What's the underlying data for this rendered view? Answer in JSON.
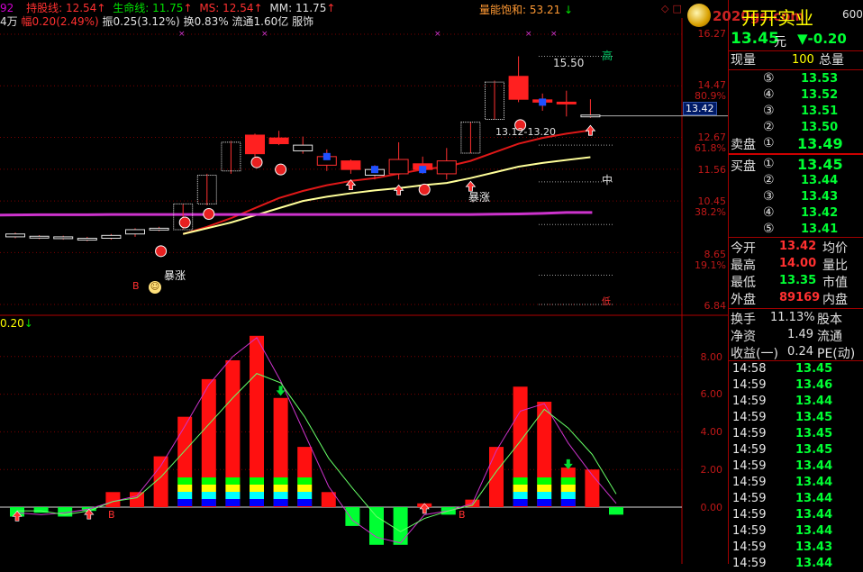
{
  "header": {
    "left_cut": "92",
    "hold_label": "持股线: 12.54",
    "life_label": "生命线: 11.75",
    "ms_label": "MS: 12.54",
    "mm_label": "MM: 11.75",
    "energy_label": "量能饱和: 53.21",
    "row2_vol": "4万",
    "row2_change": "幅0.20(2.49%)",
    "row2_amp": "振0.25(3.12%)",
    "row2_turn": "换0.83%",
    "row2_float": "流通1.60亿",
    "row2_sector": "服饰",
    "indicator_label": "0.20"
  },
  "stock": {
    "name": "开开实业",
    "code_cut": "600",
    "logo_url": "2020gs.com"
  },
  "price_axis": {
    "labels": [
      "16.27",
      "14.47",
      "80.9%",
      "12.67",
      "61.8%",
      "11.56",
      "10.45",
      "38.2%",
      "8.65",
      "19.1%",
      "6.84"
    ],
    "current": "13.42"
  },
  "indicator_axis": {
    "labels": [
      "8.00",
      "6.00",
      "4.00",
      "2.00",
      "0.00"
    ]
  },
  "annotations": {
    "high_price": "15.50",
    "high_tag": "高",
    "range_label": "13.12-13.20",
    "mid_tag": "中",
    "low_tag": "低",
    "surge1": "暴涨",
    "surge2": "暴涨",
    "buy1": "B",
    "buy2": "B",
    "buy3": "B"
  },
  "quote": {
    "price": "13.45",
    "unit": "元",
    "change": "▼-0.20",
    "now_label": "现量",
    "now_vol": "100",
    "total_label": "总量",
    "sell_label": "卖盘",
    "buy_label": "买盘",
    "sells": [
      {
        "level": "⑤",
        "price": "13.53"
      },
      {
        "level": "④",
        "price": "13.52"
      },
      {
        "level": "③",
        "price": "13.51"
      },
      {
        "level": "②",
        "price": "13.50"
      },
      {
        "level": "①",
        "price": "13.49"
      }
    ],
    "buys": [
      {
        "level": "①",
        "price": "13.45"
      },
      {
        "level": "②",
        "price": "13.44"
      },
      {
        "level": "③",
        "price": "13.43"
      },
      {
        "level": "④",
        "price": "13.42"
      },
      {
        "level": "⑤",
        "price": "13.41"
      }
    ],
    "stats": [
      {
        "label": "今开",
        "value": "13.42",
        "label2": "均价"
      },
      {
        "label": "最高",
        "value": "14.00",
        "label2": "量比"
      },
      {
        "label": "最低",
        "value": "13.35",
        "label2": "市值"
      },
      {
        "label": "外盘",
        "value": "89169",
        "label2": "内盘"
      }
    ],
    "stats2": [
      {
        "label": "换手",
        "value": "11.13%",
        "label2": "股本"
      },
      {
        "label": "净资",
        "value": "1.49",
        "label2": "流通"
      },
      {
        "label": "收益(一)",
        "value": "0.24",
        "label2": "PE(动)"
      }
    ]
  },
  "ticks": [
    {
      "time": "14:58",
      "price": "13.45"
    },
    {
      "time": "14:59",
      "price": "13.46"
    },
    {
      "time": "14:59",
      "price": "13.44"
    },
    {
      "time": "14:59",
      "price": "13.45"
    },
    {
      "time": "14:59",
      "price": "13.45"
    },
    {
      "time": "14:59",
      "price": "13.45"
    },
    {
      "time": "14:59",
      "price": "13.44"
    },
    {
      "time": "14:59",
      "price": "13.44"
    },
    {
      "time": "14:59",
      "price": "13.44"
    },
    {
      "time": "14:59",
      "price": "13.44"
    },
    {
      "time": "14:59",
      "price": "13.44"
    },
    {
      "time": "14:59",
      "price": "13.43"
    },
    {
      "time": "14:59",
      "price": "13.44"
    }
  ],
  "chart_data": [
    {
      "type": "candlestick",
      "ylim": [
        6.84,
        16.27
      ],
      "candles": [
        {
          "o": 9.2,
          "c": 9.3,
          "h": 9.35,
          "l": 9.15
        },
        {
          "o": 9.18,
          "c": 9.22,
          "h": 9.26,
          "l": 9.12
        },
        {
          "o": 9.15,
          "c": 9.2,
          "h": 9.24,
          "l": 9.1
        },
        {
          "o": 9.1,
          "c": 9.15,
          "h": 9.2,
          "l": 9.05
        },
        {
          "o": 9.15,
          "c": 9.25,
          "h": 9.3,
          "l": 9.1
        },
        {
          "o": 9.3,
          "c": 9.45,
          "h": 9.5,
          "l": 9.2
        },
        {
          "o": 9.5,
          "c": 9.5,
          "h": 9.55,
          "l": 9.4
        },
        {
          "o": 9.45,
          "c": 10.35,
          "h": 10.35,
          "l": 9.45
        },
        {
          "o": 10.35,
          "c": 11.35,
          "h": 11.4,
          "l": 10.3
        },
        {
          "o": 11.5,
          "c": 12.5,
          "h": 12.55,
          "l": 11.4
        },
        {
          "o": 12.75,
          "c": 12.1,
          "h": 12.8,
          "l": 12.0
        },
        {
          "o": 12.65,
          "c": 12.45,
          "h": 12.9,
          "l": 12.4
        },
        {
          "o": 12.2,
          "c": 12.4,
          "h": 12.7,
          "l": 12.1
        },
        {
          "o": 11.7,
          "c": 12.0,
          "h": 12.25,
          "l": 11.5
        },
        {
          "o": 11.85,
          "c": 11.55,
          "h": 11.9,
          "l": 11.4
        },
        {
          "o": 11.35,
          "c": 11.55,
          "h": 11.7,
          "l": 11.2
        },
        {
          "o": 11.4,
          "c": 11.9,
          "h": 12.5,
          "l": 11.2
        },
        {
          "o": 11.75,
          "c": 11.55,
          "h": 12.0,
          "l": 11.4
        },
        {
          "o": 11.4,
          "c": 11.85,
          "h": 12.3,
          "l": 11.2
        },
        {
          "o": 12.12,
          "c": 13.2,
          "h": 13.2,
          "l": 12.12
        },
        {
          "o": 13.3,
          "c": 14.6,
          "h": 14.65,
          "l": 13.3
        },
        {
          "o": 14.8,
          "c": 14.0,
          "h": 15.5,
          "l": 13.9
        },
        {
          "o": 13.98,
          "c": 13.9,
          "h": 14.2,
          "l": 13.6
        },
        {
          "o": 13.9,
          "c": 13.85,
          "h": 14.3,
          "l": 13.4
        },
        {
          "o": 13.42,
          "c": 13.45,
          "h": 14.0,
          "l": 13.35
        }
      ],
      "series": [
        {
          "values": [
            null,
            null,
            null,
            null,
            null,
            null,
            null,
            9.3,
            9.55,
            9.85,
            10.2,
            10.55,
            10.8,
            11.0,
            11.15,
            11.25,
            11.4,
            11.55,
            11.65,
            11.85,
            12.15,
            12.45,
            12.65,
            12.8,
            12.92
          ]
        },
        {
          "values": [
            null,
            null,
            null,
            null,
            null,
            null,
            null,
            9.3,
            9.5,
            9.7,
            9.95,
            10.2,
            10.45,
            10.6,
            10.72,
            10.82,
            10.9,
            11.0,
            11.08,
            11.25,
            11.45,
            11.65,
            11.78,
            11.88,
            11.98
          ]
        },
        {
          "values": [
            9.96,
            9.97,
            9.97,
            9.97,
            9.98,
            9.98,
            9.98,
            9.98,
            9.98,
            9.98,
            9.98,
            9.98,
            9.98,
            9.98,
            9.98,
            9.98,
            9.98,
            9.98,
            9.98,
            9.98,
            9.99,
            10.0,
            10.02,
            10.05,
            10.05
          ]
        }
      ]
    },
    {
      "type": "bar",
      "ylim": [
        -2,
        9.5
      ],
      "values": [
        -0.5,
        -0.3,
        -0.5,
        -0.2,
        0.8,
        0.8,
        2.7,
        4.8,
        6.8,
        7.8,
        9.1,
        5.8,
        3.2,
        0.8,
        -1.0,
        -2.0,
        -2.0,
        0.2,
        -0.4,
        0.4,
        3.2,
        6.4,
        5.6,
        2.1,
        2.0,
        -0.4
      ],
      "series": [
        {
          "values": [
            -0.3,
            -0.4,
            -0.3,
            -0.1,
            0.3,
            0.6,
            2.2,
            4.3,
            6.5,
            8.0,
            9.0,
            6.7,
            3.9,
            1.1,
            -0.7,
            -1.6,
            -1.9,
            -0.4,
            -0.2,
            0.2,
            3.0,
            5.1,
            5.5,
            3.4,
            1.7,
            0.2
          ]
        },
        {
          "values": [
            -0.2,
            -0.2,
            -0.4,
            -0.2,
            0.3,
            0.5,
            1.6,
            3.0,
            4.4,
            5.8,
            7.1,
            6.6,
            4.8,
            2.6,
            1.0,
            -0.5,
            -1.3,
            -0.6,
            -0.2,
            0.1,
            1.9,
            3.5,
            5.2,
            4.2,
            2.8,
            0.7
          ]
        }
      ]
    }
  ]
}
